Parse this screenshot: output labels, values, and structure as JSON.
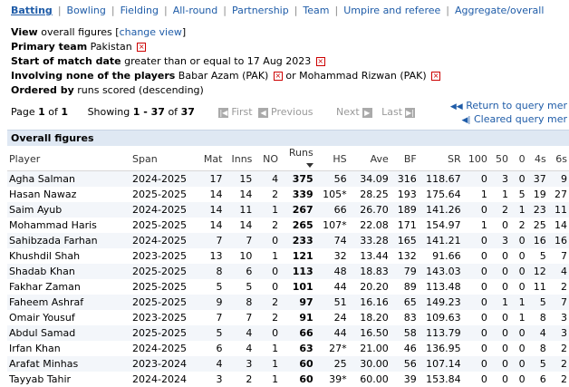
{
  "tabs": [
    {
      "label": "Batting",
      "active": true
    },
    {
      "label": "Bowling"
    },
    {
      "label": "Fielding"
    },
    {
      "label": "All-round"
    },
    {
      "label": "Partnership"
    },
    {
      "label": "Team"
    },
    {
      "label": "Umpire and referee"
    },
    {
      "label": "Aggregate/overall"
    }
  ],
  "filters": {
    "view_label": "View",
    "view_value": "overall figures",
    "change_view": "change view",
    "primary_team_label": "Primary team",
    "primary_team_value": "Pakistan",
    "start_date_label": "Start of match date",
    "start_date_value": "greater than or equal to 17 Aug 2023",
    "involving_label": "Involving none of the players",
    "player1": "Babar Azam (PAK)",
    "or_text": "or",
    "player2": "Mohammad Rizwan (PAK)",
    "ordered_label": "Ordered by",
    "ordered_value": "runs scored (descending)"
  },
  "pager": {
    "page_word": "Page",
    "page": "1",
    "of_word": "of",
    "pages": "1",
    "showing_word": "Showing",
    "range": "1 - 37",
    "total": "37",
    "first": "First",
    "previous": "Previous",
    "next": "Next",
    "last": "Last"
  },
  "links": {
    "return": "Return to query mer",
    "cleared": "Cleared query mer"
  },
  "section_title": "Overall figures",
  "columns": [
    "Player",
    "Span",
    "Mat",
    "Inns",
    "NO",
    "Runs",
    "HS",
    "Ave",
    "BF",
    "SR",
    "100",
    "50",
    "0",
    "4s",
    "6s"
  ],
  "rows": [
    [
      "Agha Salman",
      "2024-2025",
      "17",
      "15",
      "4",
      "375",
      "56",
      "34.09",
      "316",
      "118.67",
      "0",
      "3",
      "0",
      "37",
      "9"
    ],
    [
      "Hasan Nawaz",
      "2025-2025",
      "14",
      "14",
      "2",
      "339",
      "105*",
      "28.25",
      "193",
      "175.64",
      "1",
      "1",
      "5",
      "19",
      "27"
    ],
    [
      "Saim Ayub",
      "2024-2025",
      "14",
      "11",
      "1",
      "267",
      "66",
      "26.70",
      "189",
      "141.26",
      "0",
      "2",
      "1",
      "23",
      "11"
    ],
    [
      "Mohammad Haris",
      "2025-2025",
      "14",
      "14",
      "2",
      "265",
      "107*",
      "22.08",
      "171",
      "154.97",
      "1",
      "0",
      "2",
      "25",
      "14"
    ],
    [
      "Sahibzada Farhan",
      "2024-2025",
      "7",
      "7",
      "0",
      "233",
      "74",
      "33.28",
      "165",
      "141.21",
      "0",
      "3",
      "0",
      "16",
      "16"
    ],
    [
      "Khushdil Shah",
      "2023-2025",
      "13",
      "10",
      "1",
      "121",
      "32",
      "13.44",
      "132",
      "91.66",
      "0",
      "0",
      "0",
      "5",
      "7"
    ],
    [
      "Shadab Khan",
      "2025-2025",
      "8",
      "6",
      "0",
      "113",
      "48",
      "18.83",
      "79",
      "143.03",
      "0",
      "0",
      "0",
      "12",
      "4"
    ],
    [
      "Fakhar Zaman",
      "2025-2025",
      "5",
      "5",
      "0",
      "101",
      "44",
      "20.20",
      "89",
      "113.48",
      "0",
      "0",
      "0",
      "11",
      "2"
    ],
    [
      "Faheem Ashraf",
      "2025-2025",
      "9",
      "8",
      "2",
      "97",
      "51",
      "16.16",
      "65",
      "149.23",
      "0",
      "1",
      "1",
      "5",
      "7"
    ],
    [
      "Omair Yousuf",
      "2023-2025",
      "7",
      "7",
      "2",
      "91",
      "24",
      "18.20",
      "83",
      "109.63",
      "0",
      "0",
      "1",
      "8",
      "3"
    ],
    [
      "Abdul Samad",
      "2025-2025",
      "5",
      "4",
      "0",
      "66",
      "44",
      "16.50",
      "58",
      "113.79",
      "0",
      "0",
      "0",
      "4",
      "3"
    ],
    [
      "Irfan Khan",
      "2024-2025",
      "6",
      "4",
      "1",
      "63",
      "27*",
      "21.00",
      "46",
      "136.95",
      "0",
      "0",
      "0",
      "8",
      "2"
    ],
    [
      "Arafat Minhas",
      "2023-2024",
      "4",
      "3",
      "1",
      "60",
      "25",
      "30.00",
      "56",
      "107.14",
      "0",
      "0",
      "0",
      "5",
      "2"
    ],
    [
      "Tayyab Tahir",
      "2024-2024",
      "3",
      "2",
      "1",
      "60",
      "39*",
      "60.00",
      "39",
      "153.84",
      "0",
      "0",
      "0",
      "6",
      "2"
    ]
  ]
}
